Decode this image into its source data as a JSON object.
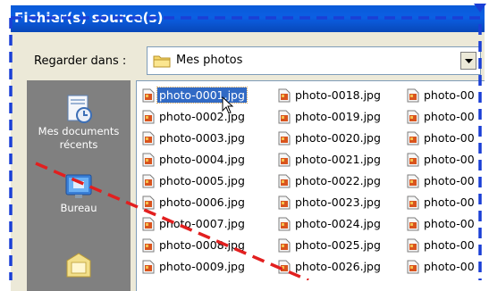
{
  "dialog": {
    "title": "Fichier(s) source(s)",
    "look_in_label": "Regarder dans :",
    "look_in_value": "Mes photos"
  },
  "places": [
    {
      "label": "Mes documents récents",
      "icon": "recent-documents-icon"
    },
    {
      "label": "Bureau",
      "icon": "desktop-icon"
    },
    {
      "label": "",
      "icon": "my-documents-icon"
    }
  ],
  "files": {
    "col1": [
      "photo-0001.jpg",
      "photo-0002.jpg",
      "photo-0003.jpg",
      "photo-0004.jpg",
      "photo-0005.jpg",
      "photo-0006.jpg",
      "photo-0007.jpg",
      "photo-0008.jpg",
      "photo-0009.jpg"
    ],
    "col2": [
      "photo-0018.jpg",
      "photo-0019.jpg",
      "photo-0020.jpg",
      "photo-0021.jpg",
      "photo-0022.jpg",
      "photo-0023.jpg",
      "photo-0024.jpg",
      "photo-0025.jpg",
      "photo-0026.jpg"
    ],
    "col3": [
      "photo-00",
      "photo-00",
      "photo-00",
      "photo-00",
      "photo-00",
      "photo-00",
      "photo-00",
      "photo-00",
      "photo-00"
    ],
    "selected": "photo-0001.jpg"
  },
  "colors": {
    "titlebar": "#0b5fe3",
    "selection": "#316ac5",
    "places_bar": "#808080",
    "blue_dashed_annotation": "#1a3fd6",
    "red_dashed_annotation": "#e21f1f"
  }
}
